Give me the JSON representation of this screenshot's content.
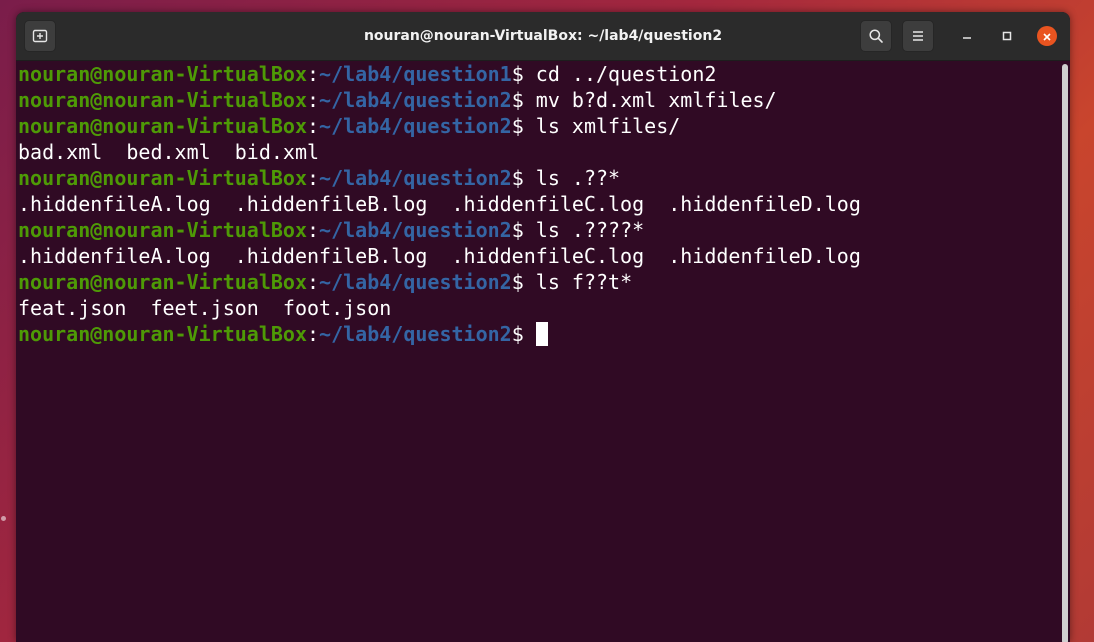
{
  "window": {
    "title": "nouran@nouran-VirtualBox: ~/lab4/question2"
  },
  "icons": {
    "new_tab": "new-tab-icon",
    "search": "search-icon",
    "menu": "hamburger-menu-icon",
    "minimize": "minimize-icon",
    "maximize": "maximize-icon",
    "close": "close-icon"
  },
  "colors": {
    "terminal_bg": "#300a24",
    "prompt_user": "#4e9a06",
    "prompt_path": "#3465a4",
    "text": "#ffffff",
    "close_button": "#e95420"
  },
  "terminal": {
    "lines": [
      {
        "user": "nouran@nouran-VirtualBox",
        "sep": ":",
        "path": "~/lab4/question1",
        "symbol": "$ ",
        "command": "cd ../question2"
      },
      {
        "user": "nouran@nouran-VirtualBox",
        "sep": ":",
        "path": "~/lab4/question2",
        "symbol": "$ ",
        "command": "mv b?d.xml xmlfiles/"
      },
      {
        "user": "nouran@nouran-VirtualBox",
        "sep": ":",
        "path": "~/lab4/question2",
        "symbol": "$ ",
        "command": "ls xmlfiles/"
      },
      {
        "output": "bad.xml  bed.xml  bid.xml"
      },
      {
        "user": "nouran@nouran-VirtualBox",
        "sep": ":",
        "path": "~/lab4/question2",
        "symbol": "$ ",
        "command": "ls .??*"
      },
      {
        "output": ".hiddenfileA.log  .hiddenfileB.log  .hiddenfileC.log  .hiddenfileD.log"
      },
      {
        "user": "nouran@nouran-VirtualBox",
        "sep": ":",
        "path": "~/lab4/question2",
        "symbol": "$ ",
        "command": "ls .????*"
      },
      {
        "output": ".hiddenfileA.log  .hiddenfileB.log  .hiddenfileC.log  .hiddenfileD.log"
      },
      {
        "user": "nouran@nouran-VirtualBox",
        "sep": ":",
        "path": "~/lab4/question2",
        "symbol": "$ ",
        "command": "ls f??t*"
      },
      {
        "output": "feat.json  feet.json  foot.json"
      },
      {
        "user": "nouran@nouran-VirtualBox",
        "sep": ":",
        "path": "~/lab4/question2",
        "symbol": "$ ",
        "command": "",
        "cursor": true
      }
    ]
  }
}
